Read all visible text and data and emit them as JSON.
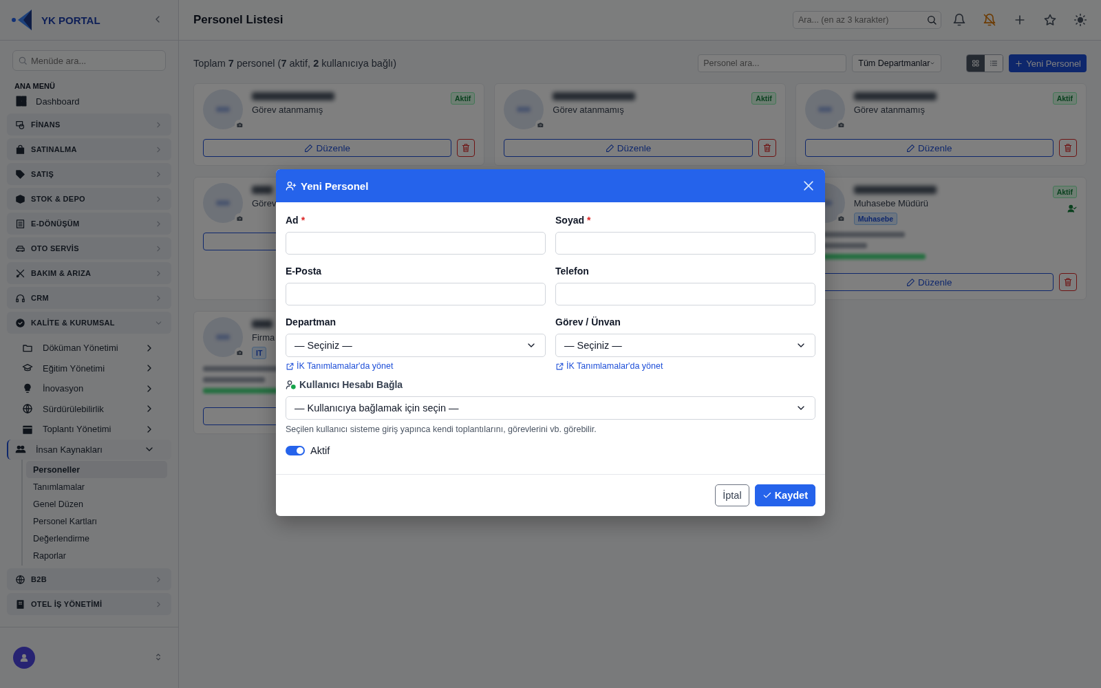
{
  "sidebar": {
    "brand": "YK PORTAL",
    "search": {
      "placeholder": "Menüde ara..."
    },
    "section_title": "ANA MENÜ",
    "items": [
      {
        "label": "Dashboard",
        "kind": "link"
      },
      {
        "label": "FİNANS",
        "kind": "group",
        "expanded": false
      },
      {
        "label": "SATINALMA",
        "kind": "group",
        "expanded": false
      },
      {
        "label": "SATIŞ",
        "kind": "group",
        "expanded": false
      },
      {
        "label": "STOK & DEPO",
        "kind": "group",
        "expanded": false
      },
      {
        "label": "E-DÖNÜŞÜM",
        "kind": "group",
        "expanded": false
      },
      {
        "label": "OTO SERVİS",
        "kind": "group",
        "expanded": false
      },
      {
        "label": "BAKIM & ARIZA",
        "kind": "group",
        "expanded": false
      },
      {
        "label": "CRM",
        "kind": "group",
        "expanded": false
      },
      {
        "label": "KALİTE & KURUMSAL",
        "kind": "group",
        "expanded": true,
        "children": [
          {
            "label": "Döküman Yönetimi",
            "expanded": false,
            "selected": false
          },
          {
            "label": "Eğitim Yönetimi",
            "expanded": false,
            "selected": false
          },
          {
            "label": "İnovasyon",
            "expanded": false,
            "selected": false
          },
          {
            "label": "Sürdürülebilirlik",
            "expanded": false,
            "selected": false
          },
          {
            "label": "Toplantı Yönetimi",
            "expanded": false,
            "selected": false
          },
          {
            "label": "İnsan Kaynakları",
            "expanded": true,
            "selected": true,
            "children": [
              {
                "label": "Personeller",
                "selected": true
              },
              {
                "label": "Tanımlamalar",
                "selected": false
              },
              {
                "label": "Genel Düzen",
                "selected": false
              },
              {
                "label": "Personel Kartları",
                "selected": false
              },
              {
                "label": "Değerlendirme",
                "selected": false
              },
              {
                "label": "Raporlar",
                "selected": false
              }
            ]
          }
        ]
      },
      {
        "label": "B2B",
        "kind": "group",
        "expanded": false
      },
      {
        "label": "OTEL İŞ YÖNETİMİ",
        "kind": "group",
        "expanded": false
      }
    ]
  },
  "header": {
    "title": "Personel Listesi",
    "search": {
      "placeholder": "Ara... (en az 3 karakter)"
    }
  },
  "toolbar": {
    "summary": "Toplam **7** personel (**7** aktif, **2** kullanıcıya bağlı)",
    "search": {
      "placeholder": "Personel ara..."
    },
    "department_filter": {
      "value": "Tüm Departmanlar"
    },
    "view_modes": [
      {
        "kind": "grid",
        "selected": true
      },
      {
        "kind": "list",
        "selected": false
      }
    ],
    "new_button": "Yeni Personel"
  },
  "cards": [
    {
      "role": "Görev atanmamış",
      "status": "Aktif",
      "user_linked": false,
      "edit": "Düzenle"
    },
    {
      "role": "Görev atanmamış",
      "status": "Aktif",
      "user_linked": false,
      "edit": "Düzenle"
    },
    {
      "role": "Görev atanmamış",
      "status": "Aktif",
      "user_linked": false,
      "edit": "Düzenle"
    },
    {
      "role": "Görev",
      "user_linked": false
    },
    {
      "role": "Muhasebe Müdürü",
      "department": "Muhasebe",
      "status": "Aktif",
      "user_linked": true,
      "contacts": true,
      "edit": "Düzenle"
    },
    {
      "role": "Firma",
      "department": "IT",
      "user_linked": false,
      "contacts": true
    }
  ],
  "modal": {
    "title": "Yeni Personel",
    "fields": [
      {
        "label": "Ad",
        "required_mark": "*",
        "kind": "text"
      },
      {
        "label": "Soyad",
        "required_mark": "*",
        "kind": "text"
      },
      {
        "label": "E-Posta",
        "kind": "text"
      },
      {
        "label": "Telefon",
        "kind": "text"
      },
      {
        "label": "Departman",
        "kind": "select",
        "value": "— Seçiniz —",
        "link": "İK Tanımlamalar'da yönet"
      },
      {
        "label": "Görev / Ünvan",
        "kind": "select",
        "value": "— Seçiniz —",
        "link": "İK Tanımlamalar'da yönet"
      }
    ],
    "user_link": {
      "label": "Kullanıcı Hesabı Bağla",
      "value": "— Kullanıcıya bağlamak için seçin —",
      "help": "Seçilen kullanıcı sisteme giriş yapınca kendi toplantılarını, görevlerini vb. görebilir."
    },
    "active_toggle": {
      "label": "Aktif",
      "on": true
    },
    "buttons": [
      {
        "label": "İptal",
        "kind": "secondary"
      },
      {
        "label": "Kaydet",
        "kind": "primary"
      }
    ]
  }
}
